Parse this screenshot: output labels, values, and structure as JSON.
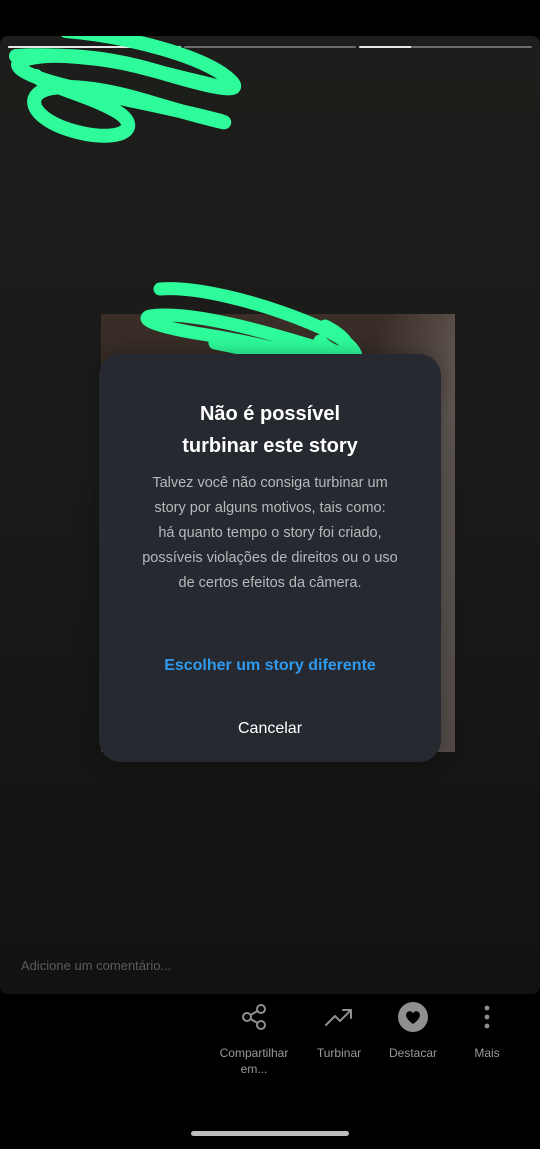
{
  "story": {
    "progress_segments": [
      {
        "filled": 1.0
      },
      {
        "filled": 0.0
      },
      {
        "filled": 0.3
      }
    ],
    "comment_placeholder": "Adicione um comentário..."
  },
  "dialog": {
    "title_line1": "Não é possível",
    "title_line2": "turbinar este story",
    "body_lines": [
      "Talvez você não consiga turbinar um",
      "story por alguns motivos, tais como:",
      "há quanto tempo o story foi criado,",
      "possíveis violações de direitos ou o uso",
      "de certos efeitos da câmera."
    ],
    "primary_action": "Escolher um story diferente",
    "cancel_action": "Cancelar"
  },
  "bottom_bar": {
    "items": [
      {
        "label_line1": "Compartilhar",
        "label_line2": "em...",
        "icon": "share-icon"
      },
      {
        "label_line1": "Turbinar",
        "label_line2": "",
        "icon": "trending-up-icon"
      },
      {
        "label_line1": "Destacar",
        "label_line2": "",
        "icon": "heart-circle-icon"
      },
      {
        "label_line1": "Mais",
        "label_line2": "",
        "icon": "more-vertical-icon"
      }
    ]
  },
  "colors": {
    "accent_link": "#2f9bf0",
    "redaction_marker": "#2efc9a",
    "dialog_bg": "#262930"
  }
}
